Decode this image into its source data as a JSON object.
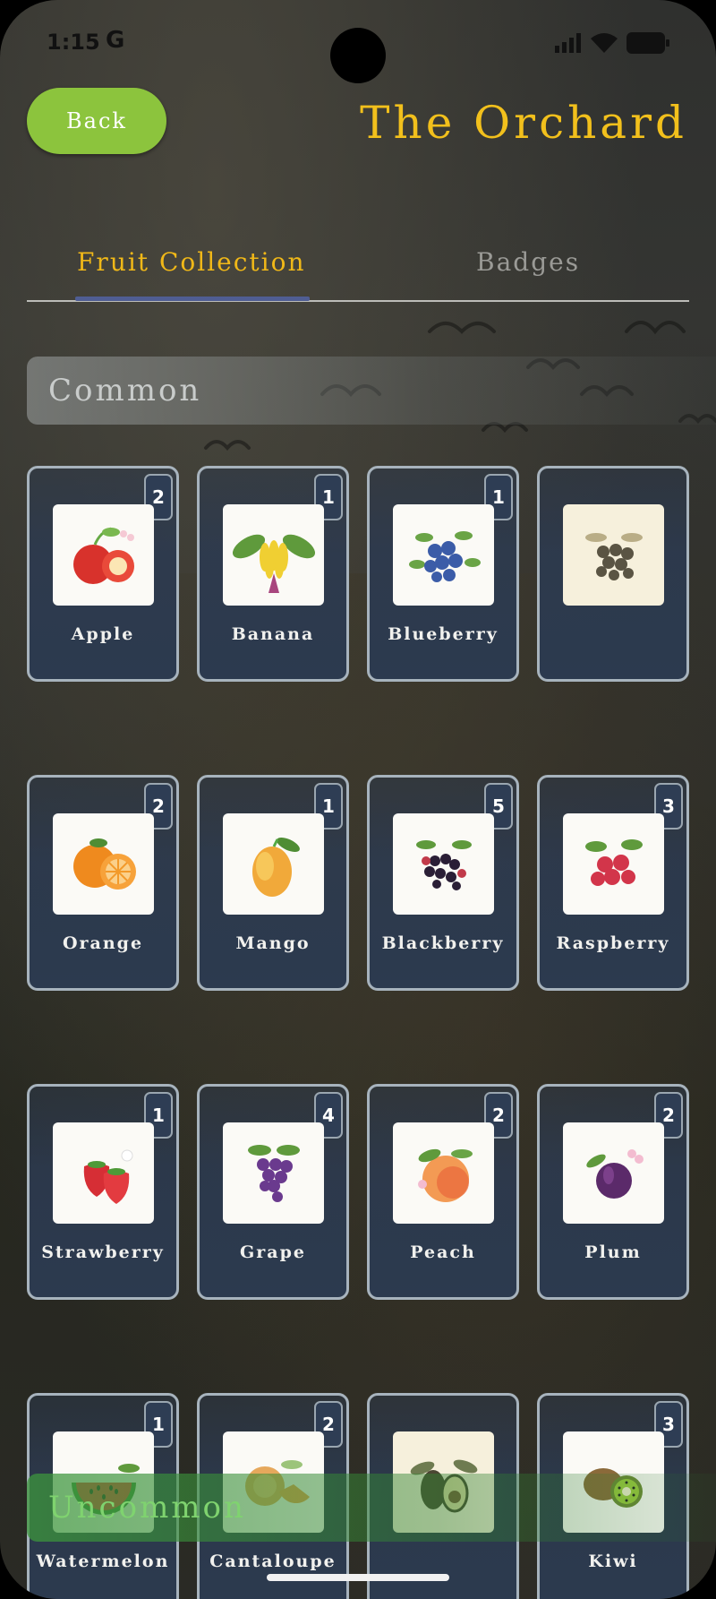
{
  "status": {
    "time": "1:15",
    "google_glyph": "G"
  },
  "header": {
    "back_label": "Back",
    "title": "The Orchard"
  },
  "tabs": [
    {
      "label": "Fruit Collection",
      "active": true
    },
    {
      "label": "Badges",
      "active": false
    }
  ],
  "sections": {
    "common": "Common",
    "uncommon": "Uncommon"
  },
  "colors": {
    "accent": "#f2c01c",
    "back_button": "#8cc43d",
    "tab_underline": "#4f5d93",
    "card_bg": "#2c3a4f",
    "card_border": "#a7b3bd",
    "uncommon_text": "#7fd36f"
  },
  "fruits": [
    {
      "name": "Apple",
      "count": "2",
      "icon": "apple-icon",
      "locked": false
    },
    {
      "name": "Banana",
      "count": "1",
      "icon": "banana-icon",
      "locked": false
    },
    {
      "name": "Blueberry",
      "count": "1",
      "icon": "blueberry-icon",
      "locked": false
    },
    {
      "name": "",
      "count": "",
      "icon": "locked-fruit-icon",
      "locked": true
    },
    {
      "name": "Orange",
      "count": "2",
      "icon": "orange-icon",
      "locked": false
    },
    {
      "name": "Mango",
      "count": "1",
      "icon": "mango-icon",
      "locked": false
    },
    {
      "name": "Blackberry",
      "count": "5",
      "icon": "blackberry-icon",
      "locked": false
    },
    {
      "name": "Raspberry",
      "count": "3",
      "icon": "raspberry-icon",
      "locked": false
    },
    {
      "name": "Strawberry",
      "count": "1",
      "icon": "strawberry-icon",
      "locked": false
    },
    {
      "name": "Grape",
      "count": "4",
      "icon": "grape-icon",
      "locked": false
    },
    {
      "name": "Peach",
      "count": "2",
      "icon": "peach-icon",
      "locked": false
    },
    {
      "name": "Plum",
      "count": "2",
      "icon": "plum-icon",
      "locked": false
    },
    {
      "name": "Watermelon",
      "count": "1",
      "icon": "watermelon-icon",
      "locked": false
    },
    {
      "name": "Cantaloupe",
      "count": "2",
      "icon": "cantaloupe-icon",
      "locked": false
    },
    {
      "name": "",
      "count": "",
      "icon": "avocado-icon",
      "locked": true
    },
    {
      "name": "Kiwi",
      "count": "3",
      "icon": "kiwi-icon",
      "locked": false
    }
  ]
}
